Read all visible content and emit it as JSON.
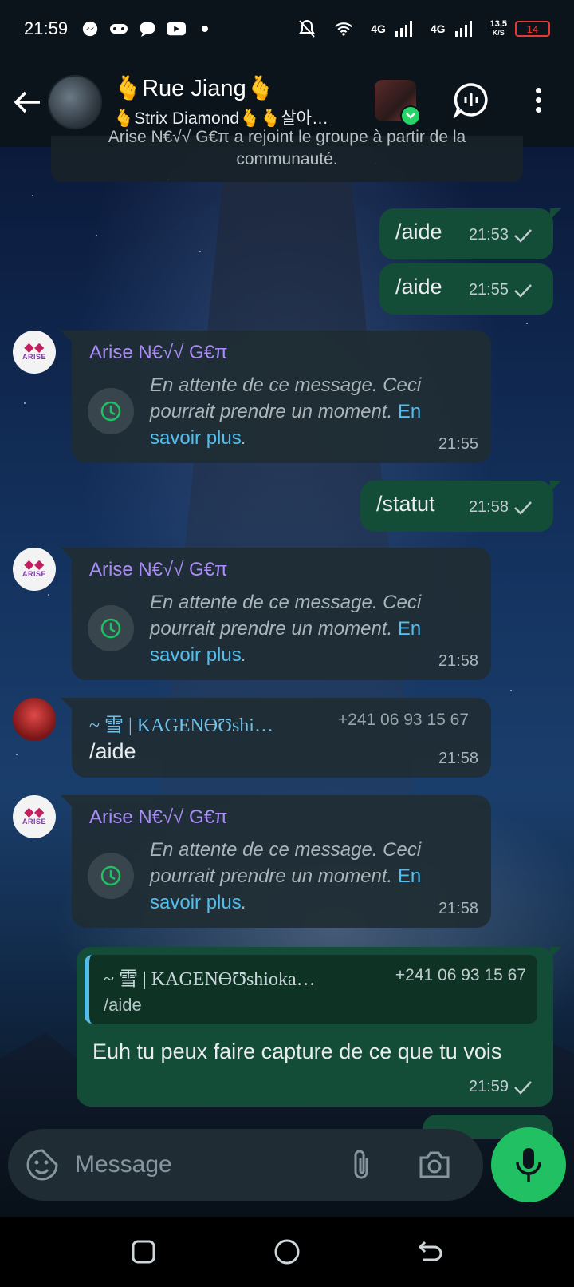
{
  "status_bar": {
    "time": "21:59",
    "network_1": "4G",
    "network_2": "4G",
    "speed_value": "13,5",
    "speed_unit": "K/S",
    "battery": "14"
  },
  "header": {
    "title": "🫰Rue Jiang🫰",
    "subtitle": "🫰Strix Diamond🫰🫰살아…"
  },
  "messages": {
    "system": {
      "line1": "Arise N€√√ G€π a rejoint le groupe à partir de la",
      "line2": "communauté."
    },
    "out1": {
      "text": "/aide",
      "time": "21:53"
    },
    "out2": {
      "text": "/aide",
      "time": "21:55"
    },
    "in1": {
      "sender": "Arise N€√√ G€π",
      "waiting": "En attente de ce message. Ceci pourrait prendre un moment.",
      "link": "En savoir plus",
      "period": ".",
      "time": "21:55"
    },
    "out3": {
      "text": "/statut",
      "time": "21:58"
    },
    "in2": {
      "sender": "Arise N€√√ G€π",
      "waiting": "En attente de ce message. Ceci pourrait prendre un moment.",
      "link": "En savoir plus",
      "period": ".",
      "time": "21:58"
    },
    "in3": {
      "sender": "~ 雪 | KAGENƟƱshi…",
      "phone": "+241 06 93 15 67",
      "text": "/aide",
      "time": "21:58"
    },
    "in4": {
      "sender": "Arise N€√√ G€π",
      "waiting": "En attente de ce message. Ceci pourrait prendre un moment.",
      "link": "En savoir plus",
      "period": ".",
      "time": "21:58"
    },
    "out4": {
      "quote_sender": "~ 雪 | KAGENƟƱshioka…",
      "quote_phone": "+241 06 93 15 67",
      "quote_text": "/aide",
      "text": "Euh tu peux faire capture de ce que tu vois",
      "time": "21:59"
    }
  },
  "avatar_logo": "ARISE",
  "input": {
    "placeholder": "Message"
  },
  "icons": {
    "back": "arrow-left-icon",
    "voice_chat": "voice-chat-icon",
    "menu": "more-vert-icon",
    "clock": "clock-icon",
    "check": "check-icon",
    "sticker": "sticker-icon",
    "attach": "paperclip-icon",
    "camera": "camera-icon",
    "mic": "mic-icon"
  },
  "colors": {
    "outgoing_bubble": "#144d37",
    "incoming_bubble": "#202c33",
    "accent_green": "#21c063",
    "link_blue": "#53bdeb",
    "sender_purple": "#a98cf5"
  }
}
